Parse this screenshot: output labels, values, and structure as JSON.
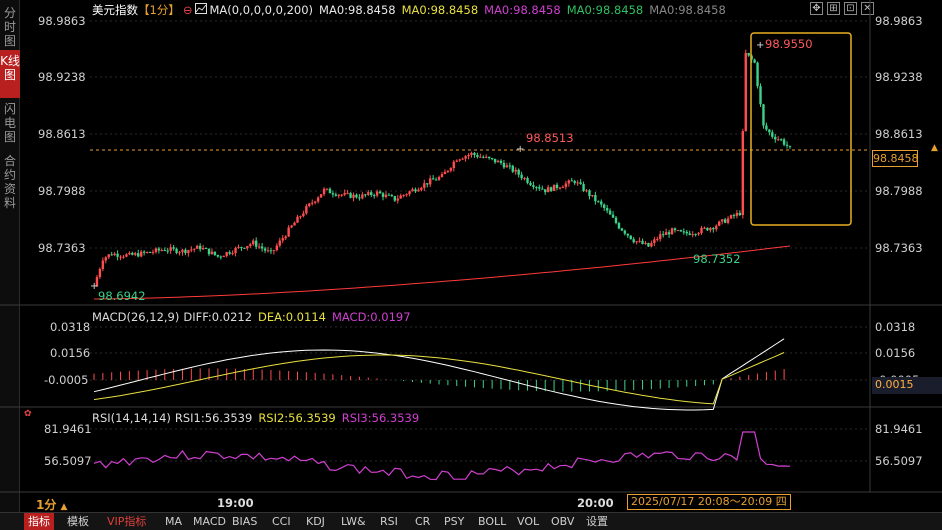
{
  "sidebar": {
    "tabs": [
      {
        "label": "分时图",
        "active": false
      },
      {
        "label": "K线图",
        "active": true
      },
      {
        "label": "闪电图",
        "active": false
      },
      {
        "label": "合约资料",
        "active": false
      }
    ]
  },
  "main": {
    "title": "美元指数",
    "period": "【1分】",
    "ma_params": "MA(0,0,0,0,0,200)",
    "ma_values": [
      "MA0:98.8458",
      "MA0:98.8458",
      "MA0:98.8458",
      "MA0:98.8458",
      "MA0:98.8458"
    ],
    "ma_colors": [
      "#e8e8e8",
      "#e8e040",
      "#d040d0",
      "#30c060",
      "#888888"
    ],
    "axis_labels": [
      "98.9863",
      "98.9238",
      "98.8613",
      "98.7988",
      "98.7363"
    ],
    "high_label": "98.9550",
    "mid_high_label": "98.8513",
    "low_label": "98.6942",
    "mid_low_label": "98.7352",
    "current_price": "98.8458"
  },
  "macd": {
    "header": "MACD(26,12,9)",
    "diff": "DIFF:0.0212",
    "dea": "DEA:0.0114",
    "macd": "MACD:0.0197",
    "axis_labels": [
      "0.0318",
      "0.0156",
      "-0.0005"
    ],
    "current": "0.0015"
  },
  "rsi": {
    "header": "RSI(14,14,14)",
    "rsi1": "RSI1:56.3539",
    "rsi2": "RSI2:56.3539",
    "rsi3": "RSI3:56.3539",
    "axis_labels": [
      "81.9461",
      "56.5097"
    ]
  },
  "xaxis": {
    "period": "1分",
    "times": [
      "19:00",
      "20:00"
    ],
    "date_range": "2025/07/17 20:08～20:09 四"
  },
  "bottom_tabs": [
    "指标",
    "模板",
    "VIP指标",
    "MA",
    "MACD",
    "BIAS",
    "CCI",
    "KDJ",
    "LW&",
    "RSI",
    "CR",
    "PSY",
    "BOLL",
    "VOL",
    "OBV",
    "设置"
  ],
  "colors": {
    "up": "#ff4d4d",
    "down": "#3bd38a",
    "ma200": "#ff3a3a",
    "diff": "#ffffff",
    "dea": "#e8e040",
    "rsi": "#d040d0",
    "highlight": "#e8b020"
  }
}
